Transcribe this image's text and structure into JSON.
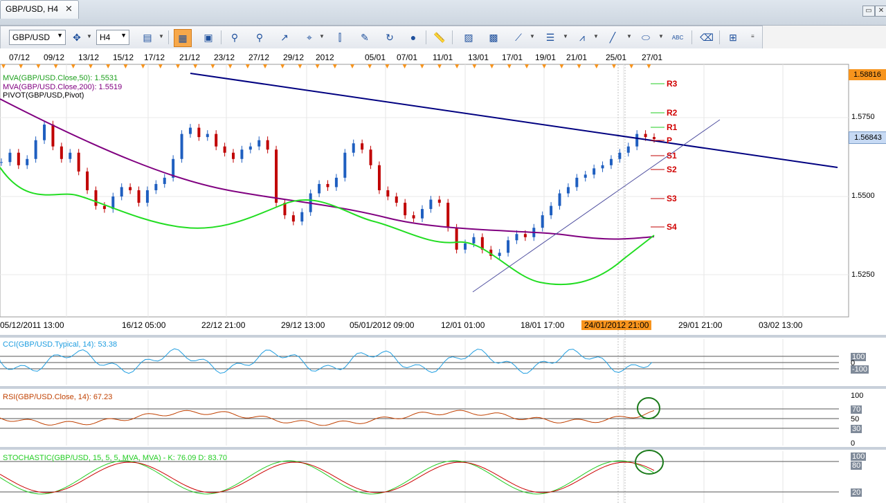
{
  "tab": {
    "title": "GBP/USD, H4",
    "close": "✕"
  },
  "window": {
    "restore": "▭",
    "close": "✕"
  },
  "toolbar": {
    "symbol": "GBP/USD",
    "timeframe": "H4"
  },
  "top_dates": [
    "07/12",
    "09/12",
    "13/12",
    "15/12",
    "17/12",
    "21/12",
    "23/12",
    "27/12",
    "29/12",
    "2012",
    "05/01",
    "07/01",
    "11/01",
    "13/01",
    "17/01",
    "19/01",
    "21/01",
    "25/01",
    "27/01"
  ],
  "bottom_dates": [
    "05/12/2011 13:00",
    "16/12 05:00",
    "22/12 21:00",
    "29/12 13:00",
    "05/01/2012 09:00",
    "12/01 01:00",
    "18/01 17:00",
    "24/01/2012 21:00",
    "29/01 21:00",
    "03/02 13:00"
  ],
  "legend": {
    "mva50": "MVA(GBP/USD.Close,50): 1.5531",
    "mva200": "MVA(GBP/USD.Close,200): 1.5519",
    "pivot": "PIVOT(GBP/USD,Pivot)"
  },
  "price_axis": {
    "ticks": [
      "1.5750",
      "1.5500",
      "1.5250"
    ],
    "high_box": "1.58816",
    "current_box": "1.56843"
  },
  "pivot_levels": [
    "R3",
    "R2",
    "R1",
    "P",
    "S1",
    "S2",
    "S3",
    "S4"
  ],
  "cci": {
    "label": "CCI(GBP/USD.Typical, 14): 53.38",
    "ticks": [
      "100",
      "0",
      "-100"
    ]
  },
  "rsi": {
    "label": "RSI(GBP/USD.Close, 14): 67.23",
    "ticks": [
      "100",
      "70",
      "50",
      "30",
      "0"
    ]
  },
  "stoch": {
    "label": "STOCHASTIC(GBP/USD, 15, 5, 5, MVA, MVA) - K: 76.09  D: 83.70",
    "ticks": [
      "100",
      "80",
      "20"
    ]
  },
  "colors": {
    "mva50": "#22dd22",
    "mva200": "#800080",
    "trend": "#000080",
    "bull": "#1f5fc0",
    "bear": "#c00000",
    "cci": "#1e9de0",
    "rsi": "#c04000",
    "stoch_k": "#22cc22",
    "stoch_d": "#cc0000",
    "highlight": "#f7941d"
  }
}
